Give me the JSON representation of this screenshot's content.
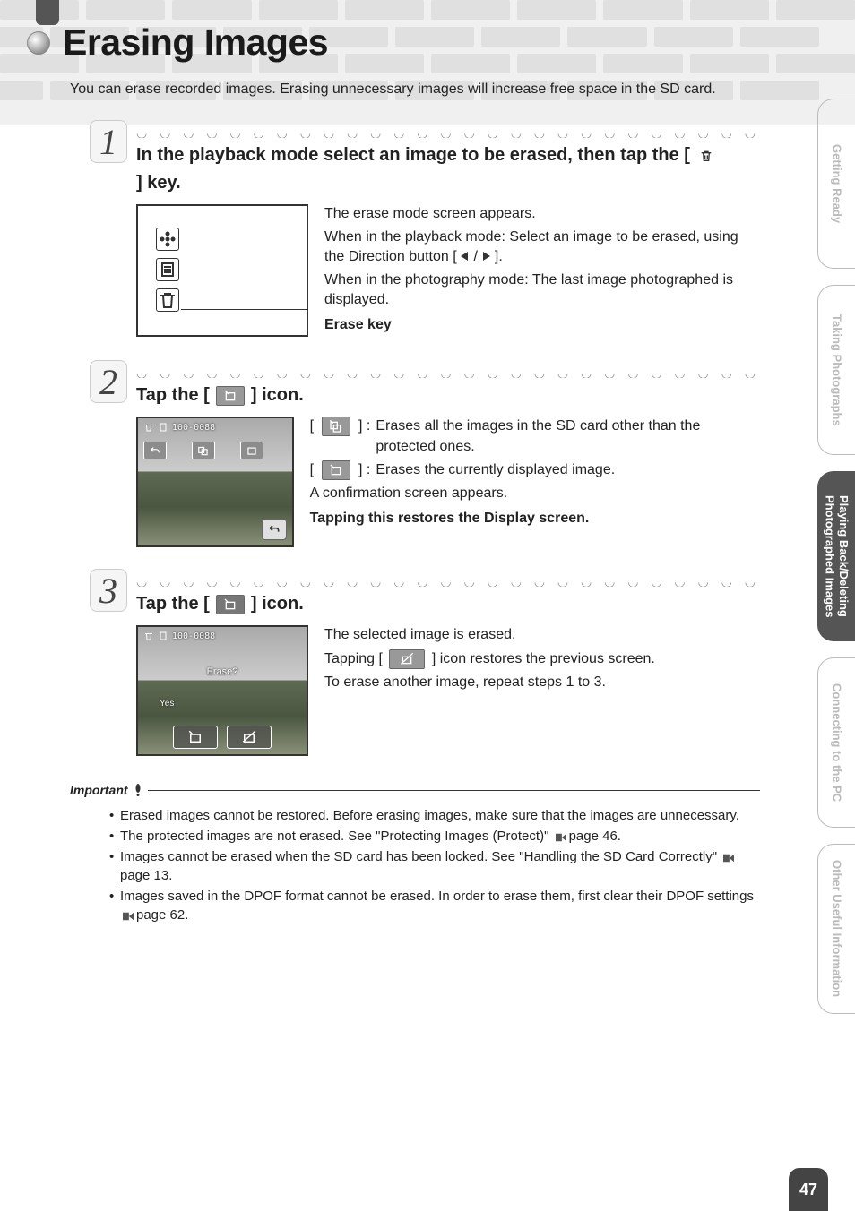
{
  "page_title": "Erasing Images",
  "intro": "You can erase recorded images. Erasing unnecessary images will increase free space in the SD card.",
  "steps": [
    {
      "num": "1",
      "heading_pre": "In the playback mode select an image to be erased, then tap the [",
      "heading_post": "] key.",
      "icon": "trash",
      "desc": {
        "line1": "The erase mode screen appears.",
        "line2a": "When in the playback mode: Select an image to be erased, using the Direction button [",
        "line2b": "].",
        "line3": "When in the photography mode: The last image photographed is displayed.",
        "label": "Erase key"
      }
    },
    {
      "num": "2",
      "heading_pre": "Tap the [",
      "heading_post": "] icon.",
      "icon": "erase-single",
      "desc": {
        "bullet1": "Erases all the images in the SD card other than the protected ones.",
        "bullet2": "Erases the currently displayed image.",
        "line1": "A confirmation screen appears.",
        "label": "Tapping this restores the Display screen."
      },
      "fig_label": "100-0088"
    },
    {
      "num": "3",
      "heading_pre": "Tap the [",
      "heading_post": "] icon.",
      "icon": "erase-confirm",
      "desc": {
        "line1": "The selected image is erased.",
        "line2a": "Tapping [",
        "line2b": "] icon restores the previous screen.",
        "line3": "To erase another image, repeat steps 1 to 3."
      },
      "fig_label": "100-0088",
      "fig_erase": "Erase?",
      "fig_yes": "Yes"
    }
  ],
  "important": {
    "heading": "Important",
    "items": [
      {
        "text_a": "Erased images cannot be restored. Before erasing images, make sure that the images are unnecessary."
      },
      {
        "text_a": "The protected images are not erased. See \"Protecting Images (Protect)\" ",
        "page": "page 46."
      },
      {
        "text_a": "Images cannot be erased when the SD card has been locked. See \"Handling the SD Card Correctly\" ",
        "page": "page 13."
      },
      {
        "text_a": "Images saved in the DPOF format cannot be erased. In order to erase them, first clear their DPOF settings ",
        "page": "page 62."
      }
    ]
  },
  "side_tabs": [
    {
      "label": "Getting Ready",
      "active": false
    },
    {
      "label": "Taking Photographs",
      "active": false
    },
    {
      "label": "Playing Back/Deleting Photographed Images",
      "active": true
    },
    {
      "label": "Connecting to the PC",
      "active": false
    },
    {
      "label": "Other Useful Information",
      "active": false
    }
  ],
  "page_number": "47"
}
